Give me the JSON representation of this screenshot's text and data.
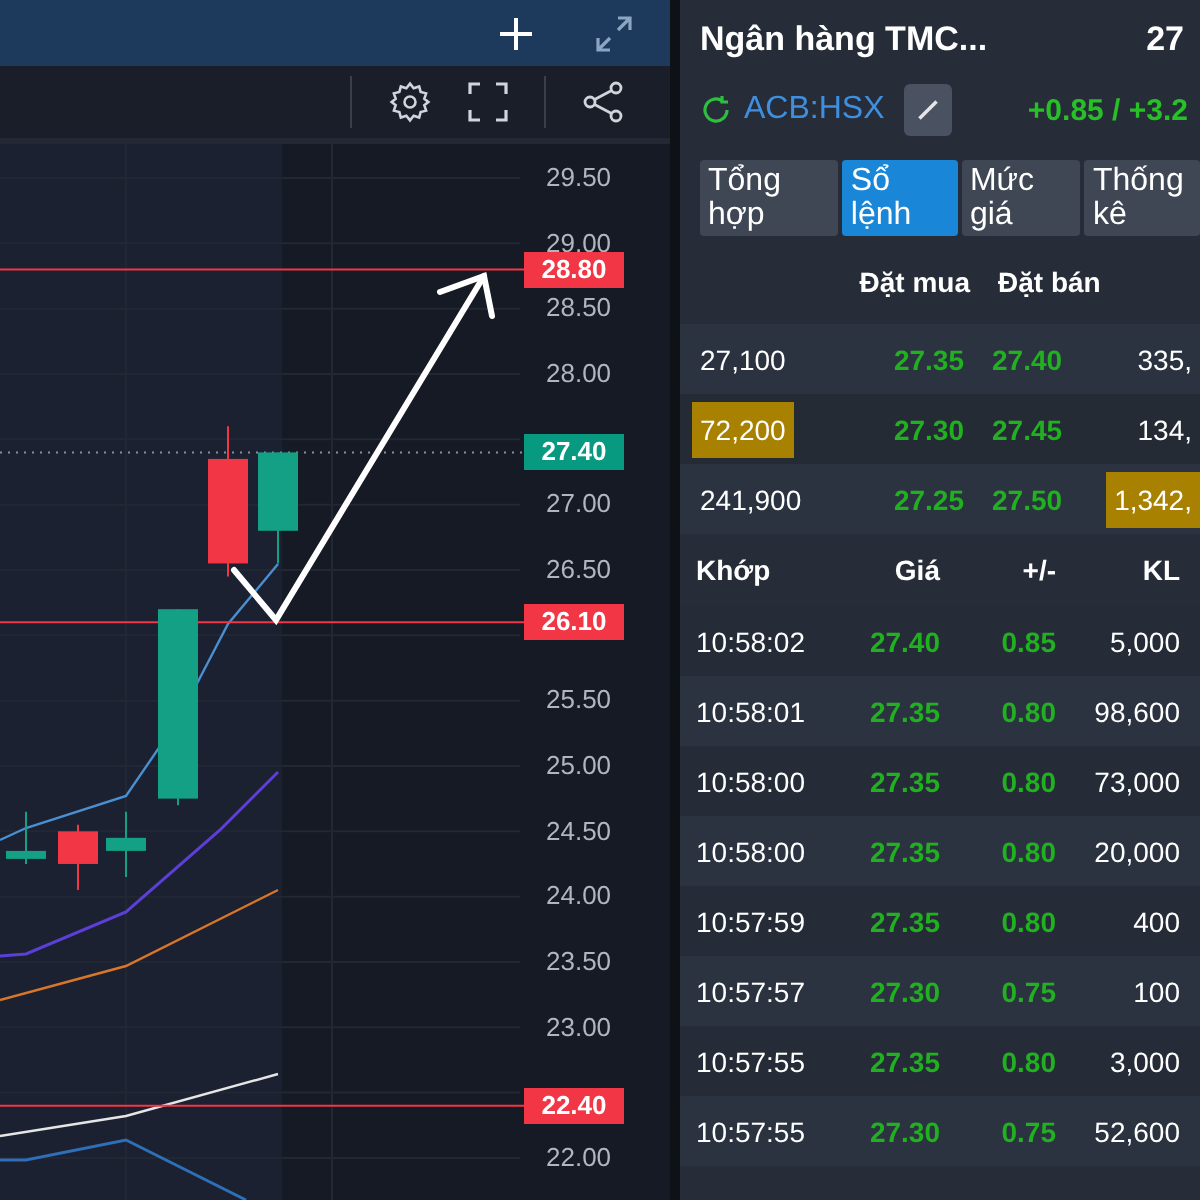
{
  "chart": {
    "price_axis": [
      "29.50",
      "29.00",
      "28.50",
      "28.00",
      "27.00",
      "26.50",
      "25.50",
      "25.00",
      "24.50",
      "24.00",
      "23.50",
      "23.00",
      "22.00"
    ],
    "price_tags": [
      {
        "label": "28.80",
        "color": "#f23645",
        "kind": "level"
      },
      {
        "label": "27.40",
        "color": "#089981",
        "kind": "last"
      },
      {
        "label": "26.10",
        "color": "#f23645",
        "kind": "level"
      },
      {
        "label": "22.40",
        "color": "#f23645",
        "kind": "level"
      }
    ]
  },
  "quote": {
    "name": "Ngân hàng TMC...",
    "price": "27",
    "symbol": "ACB:HSX",
    "change": "+0.85 / +3.2"
  },
  "tabs": [
    {
      "label": "Tổng hợp",
      "selected": false
    },
    {
      "label": "Sổ lệnh",
      "selected": true
    },
    {
      "label": "Mức giá",
      "selected": false
    },
    {
      "label": "Thống kê",
      "selected": false
    }
  ],
  "order_book": {
    "columns": [
      "Đặt mua",
      "Đặt bán"
    ],
    "rows": [
      {
        "bid_volume": "27,100",
        "bid_highlight": false,
        "bid_price": "27.35",
        "ask_price": "27.40",
        "ask_volume": "335,",
        "ask_highlight": false
      },
      {
        "bid_volume": "72,200",
        "bid_highlight": true,
        "bid_price": "27.30",
        "ask_price": "27.45",
        "ask_volume": "134,",
        "ask_highlight": false
      },
      {
        "bid_volume": "241,900",
        "bid_highlight": false,
        "bid_price": "27.25",
        "ask_price": "27.50",
        "ask_volume": "1,342,",
        "ask_highlight": true
      }
    ]
  },
  "trades": {
    "columns": [
      "Khớp",
      "Giá",
      "+/-",
      "KL"
    ],
    "rows": [
      {
        "time": "10:58:02",
        "price": "27.40",
        "change": "0.85",
        "volume": "5,000"
      },
      {
        "time": "10:58:01",
        "price": "27.35",
        "change": "0.80",
        "volume": "98,600"
      },
      {
        "time": "10:58:00",
        "price": "27.35",
        "change": "0.80",
        "volume": "73,000"
      },
      {
        "time": "10:58:00",
        "price": "27.35",
        "change": "0.80",
        "volume": "20,000"
      },
      {
        "time": "10:57:59",
        "price": "27.35",
        "change": "0.80",
        "volume": "400"
      },
      {
        "time": "10:57:57",
        "price": "27.30",
        "change": "0.75",
        "volume": "100"
      },
      {
        "time": "10:57:55",
        "price": "27.35",
        "change": "0.80",
        "volume": "3,000"
      },
      {
        "time": "10:57:55",
        "price": "27.30",
        "change": "0.75",
        "volume": "52,600"
      }
    ]
  }
}
